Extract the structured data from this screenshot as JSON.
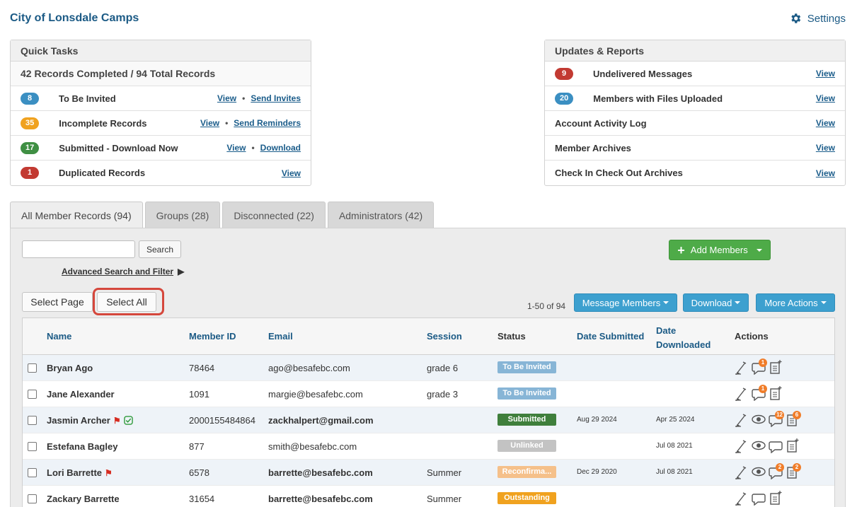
{
  "app": {
    "title": "City of Lonsdale Camps",
    "settings_label": "Settings"
  },
  "quick_tasks": {
    "title": "Quick Tasks",
    "summary": "42 Records Completed / 94 Total Records",
    "rows": [
      {
        "count": "8",
        "color": "blue",
        "label": "To Be Invited",
        "link1": "View",
        "link2": "Send Invites"
      },
      {
        "count": "35",
        "color": "orange",
        "label": "Incomplete Records",
        "link1": "View",
        "link2": "Send Reminders"
      },
      {
        "count": "17",
        "color": "green",
        "label": "Submitted - Download Now",
        "link1": "View",
        "link2": "Download"
      },
      {
        "count": "1",
        "color": "red",
        "label": "Duplicated Records",
        "link1": "View",
        "link2": ""
      }
    ]
  },
  "updates": {
    "title": "Updates & Reports",
    "rows": [
      {
        "count": "9",
        "color": "red",
        "label": "Undelivered Messages",
        "link": "View"
      },
      {
        "count": "20",
        "color": "blue",
        "label": "Members with Files Uploaded",
        "link": "View"
      },
      {
        "count": "",
        "color": "",
        "label": "Account Activity Log",
        "link": "View"
      },
      {
        "count": "",
        "color": "",
        "label": "Member Archives",
        "link": "View"
      },
      {
        "count": "",
        "color": "",
        "label": "Check In Check Out Archives",
        "link": "View"
      }
    ]
  },
  "tabs": [
    {
      "label": "All Member Records (94)",
      "active": true
    },
    {
      "label": "Groups (28)",
      "active": false
    },
    {
      "label": "Disconnected (22)",
      "active": false
    },
    {
      "label": "Administrators (42)",
      "active": false
    }
  ],
  "toolbar": {
    "search_value": "",
    "search_button": "Search",
    "advanced_search": "Advanced Search and Filter",
    "add_members": "Add Members",
    "select_page": "Select Page",
    "select_all": "Select All",
    "count_text": "1-50 of 94",
    "message_members": "Message Members",
    "download": "Download",
    "more_actions": "More Actions"
  },
  "table": {
    "headers": {
      "name": "Name",
      "member_id": "Member ID",
      "email": "Email",
      "session": "Session",
      "status": "Status",
      "date_submitted": "Date Submitted",
      "date_downloaded_1": "Date",
      "date_downloaded_2": "Downloaded",
      "actions": "Actions"
    },
    "rows": [
      {
        "name": "Bryan Ago",
        "flag": false,
        "verified": false,
        "member_id": "78464",
        "email": "ago@besafebc.com",
        "email_bold": false,
        "session": "grade 6",
        "status": "To Be Invited",
        "status_color": "#87b5d6",
        "date_submitted": "",
        "date_downloaded": "",
        "eye": false,
        "msg_badge": "1",
        "file_badge": ""
      },
      {
        "name": "Jane Alexander",
        "flag": false,
        "verified": false,
        "member_id": "1091",
        "email": "margie@besafebc.com",
        "email_bold": false,
        "session": "grade 3",
        "status": "To Be Invited",
        "status_color": "#87b5d6",
        "date_submitted": "",
        "date_downloaded": "",
        "eye": false,
        "msg_badge": "1",
        "file_badge": ""
      },
      {
        "name": "Jasmin Archer",
        "flag": true,
        "verified": true,
        "member_id": "2000155484864",
        "email": "zackhalpert@gmail.com",
        "email_bold": true,
        "session": "",
        "status": "Submitted",
        "status_color": "#3f7f3c",
        "date_submitted": "Aug 29 2024",
        "date_downloaded": "Apr 25 2024",
        "eye": true,
        "msg_badge": "12",
        "file_badge": "6"
      },
      {
        "name": "Estefana Bagley",
        "flag": false,
        "verified": false,
        "member_id": "877",
        "email": "smith@besafebc.com",
        "email_bold": false,
        "session": "",
        "status": "Unlinked",
        "status_color": "#c3c3c3",
        "date_submitted": "",
        "date_downloaded": "Jul 08 2021",
        "eye": true,
        "msg_badge": "",
        "file_badge": ""
      },
      {
        "name": "Lori Barrette",
        "flag": true,
        "verified": false,
        "member_id": "6578",
        "email": "barrette@besafebc.com",
        "email_bold": true,
        "session": "Summer",
        "status": "Reconfirma...",
        "status_color": "#f5c08a",
        "date_submitted": "Dec 29 2020",
        "date_downloaded": "Jul 08 2021",
        "eye": true,
        "msg_badge": "2",
        "file_badge": "2"
      },
      {
        "name": "Zackary Barrette",
        "flag": false,
        "verified": false,
        "member_id": "31654",
        "email": "barrette@besafebc.com",
        "email_bold": true,
        "session": "Summer",
        "status": "Outstanding",
        "status_color": "#f0a21f",
        "date_submitted": "",
        "date_downloaded": "",
        "eye": false,
        "msg_badge": "",
        "file_badge": ""
      }
    ]
  }
}
